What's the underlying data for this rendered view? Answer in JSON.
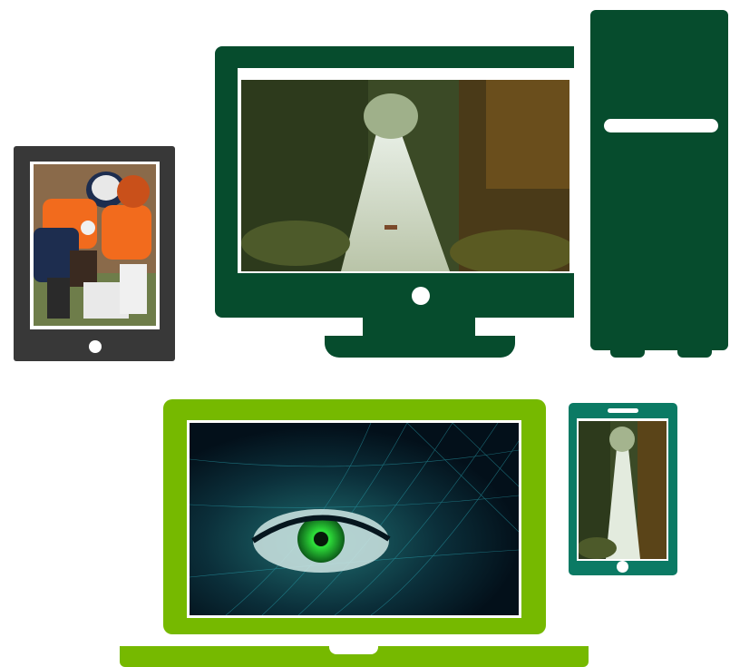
{
  "colors": {
    "tablet_body": "#383838",
    "desktop_green": "#064c2d",
    "laptop_green": "#76b900",
    "phone_teal": "#0b7a64",
    "background": "#ffffff"
  },
  "devices": {
    "tablet": {
      "screen_content": "football-players-photo"
    },
    "monitor": {
      "screen_content": "forest-river-scene"
    },
    "tower": {
      "screen_content": ""
    },
    "laptop": {
      "screen_content": "digital-eye-graphic"
    },
    "phone": {
      "screen_content": "forest-river-portrait"
    }
  }
}
